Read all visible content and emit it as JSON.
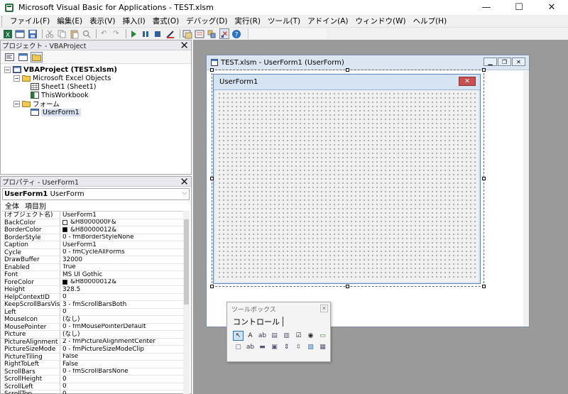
{
  "window": {
    "title": "Microsoft Visual Basic for Applications - TEST.xlsm",
    "minimize": "—",
    "maximize": "☐",
    "close": "✕"
  },
  "menu": [
    "ファイル(F)",
    "編集(E)",
    "表示(V)",
    "挿入(I)",
    "書式(O)",
    "デバッグ(D)",
    "実行(R)",
    "ツール(T)",
    "アドイン(A)",
    "ウィンドウ(W)",
    "ヘルプ(H)"
  ],
  "toolbar_icons": [
    "excel-icon",
    "insert-userform-icon",
    "save-icon",
    "cut-icon",
    "copy-icon",
    "paste-icon",
    "find-icon",
    "undo-icon",
    "redo-icon",
    "run-icon",
    "break-icon",
    "reset-icon",
    "design-mode-icon",
    "project-explorer-icon",
    "properties-icon",
    "object-browser-icon",
    "toolbox-icon",
    "help-icon"
  ],
  "project": {
    "title": "プロジェクト - VBAProject",
    "close": "✕",
    "root": "VBAProject (TEST.xlsm)",
    "excel_objects": "Microsoft Excel Objects",
    "sheet1": "Sheet1 (Sheet1)",
    "workbook": "ThisWorkbook",
    "forms": "フォーム",
    "userform": "UserForm1"
  },
  "properties": {
    "title": "プロパティ - UserForm1",
    "close": "✕",
    "object_name": "UserForm1",
    "object_type": "UserForm",
    "tab_all": "全体",
    "tab_category": "項目別",
    "rows": [
      {
        "name": "(オブジェクト名)",
        "value": "UserForm1"
      },
      {
        "name": "BackColor",
        "value": "&H8000000F&",
        "swatch": "#ffffff"
      },
      {
        "name": "BorderColor",
        "value": "&H80000012&",
        "swatch": "#000000"
      },
      {
        "name": "BorderStyle",
        "value": "0 - fmBorderStyleNone"
      },
      {
        "name": "Caption",
        "value": "UserForm1"
      },
      {
        "name": "Cycle",
        "value": "0 - fmCycleAllForms"
      },
      {
        "name": "DrawBuffer",
        "value": "32000"
      },
      {
        "name": "Enabled",
        "value": "True"
      },
      {
        "name": "Font",
        "value": "MS UI Gothic"
      },
      {
        "name": "ForeColor",
        "value": "&H80000012&",
        "swatch": "#000000"
      },
      {
        "name": "Height",
        "value": "328.5"
      },
      {
        "name": "HelpContextID",
        "value": "0"
      },
      {
        "name": "KeepScrollBarsVisible",
        "value": "3 - fmScrollBarsBoth"
      },
      {
        "name": "Left",
        "value": "0"
      },
      {
        "name": "MouseIcon",
        "value": "(なし)"
      },
      {
        "name": "MousePointer",
        "value": "0 - fmMousePointerDefault"
      },
      {
        "name": "Picture",
        "value": "(なし)"
      },
      {
        "name": "PictureAlignment",
        "value": "2 - fmPictureAlignmentCenter"
      },
      {
        "name": "PictureSizeMode",
        "value": "0 - fmPictureSizeModeClip"
      },
      {
        "name": "PictureTiling",
        "value": "False"
      },
      {
        "name": "RightToLeft",
        "value": "False"
      },
      {
        "name": "ScrollBars",
        "value": "0 - fmScrollBarsNone"
      },
      {
        "name": "ScrollHeight",
        "value": "0"
      },
      {
        "name": "ScrollLeft",
        "value": "0"
      },
      {
        "name": "ScrollTop",
        "value": "0"
      }
    ]
  },
  "designer": {
    "title": "TEST.xlsm - UserForm1 (UserForm)",
    "form_caption": "UserForm1",
    "form_close": "✕"
  },
  "toolbox": {
    "title": "ツールボックス",
    "close": "✕",
    "tab": "コントロール",
    "tools": [
      "pointer-icon",
      "label-icon",
      "textbox-icon",
      "combobox-icon",
      "listbox-icon",
      "checkbox-icon",
      "optionbutton-icon",
      "togglebutton-icon",
      "frame-icon",
      "commandbutton-icon",
      "tabstrip-icon",
      "multipage-icon",
      "scrollbar-icon",
      "spinbutton-icon",
      "image-icon",
      "refedit-icon"
    ],
    "glyphs": [
      "↖",
      "A",
      "ab",
      "▤",
      "▥",
      "☑",
      "◉",
      "▭",
      "▢",
      "ab",
      "▬",
      "▣",
      "⇕",
      "⇳",
      "▨",
      "▦"
    ]
  },
  "colors": {
    "accent": "#3a6fb0",
    "mdi_bg": "#9a9a9a",
    "close_red": "#c75050"
  }
}
